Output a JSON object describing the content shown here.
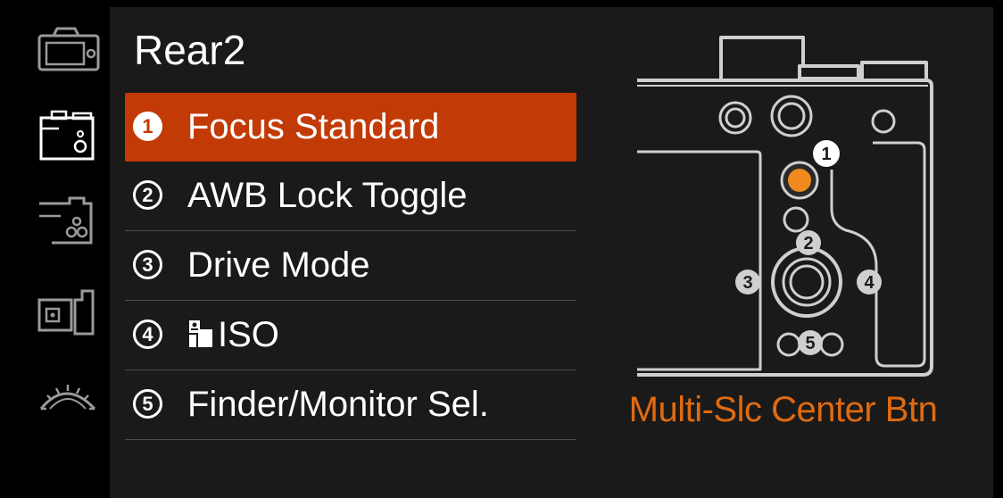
{
  "page": {
    "title": "Rear2"
  },
  "sidebar": {
    "tabs": [
      {
        "name": "camera-tab-1",
        "icon": "camera-icon"
      },
      {
        "name": "camera-tab-2",
        "icon": "camera-rear-icon",
        "active": true
      },
      {
        "name": "camera-tab-3",
        "icon": "camera-rear-buttons-icon"
      },
      {
        "name": "camera-tab-4",
        "icon": "camera-side-icon"
      },
      {
        "name": "camera-tab-5",
        "icon": "dial-icon"
      }
    ]
  },
  "menu": {
    "items": [
      {
        "number": "1",
        "label": "Focus Standard",
        "selected": true
      },
      {
        "number": "2",
        "label": "AWB Lock Toggle"
      },
      {
        "number": "3",
        "label": "Drive Mode"
      },
      {
        "number": "4",
        "label": "ISO",
        "icon": "movie-iso-icon"
      },
      {
        "number": "5",
        "label": "Finder/Monitor Sel."
      }
    ]
  },
  "diagram": {
    "caption": "Multi-Slc Center Btn",
    "markers": [
      "1",
      "2",
      "3",
      "4",
      "5"
    ]
  },
  "colors": {
    "accent": "#c23a05",
    "caption": "#e06a10",
    "highlight_dot": "#f08a1e",
    "panel": "#1a1a1a",
    "background": "#000000"
  }
}
